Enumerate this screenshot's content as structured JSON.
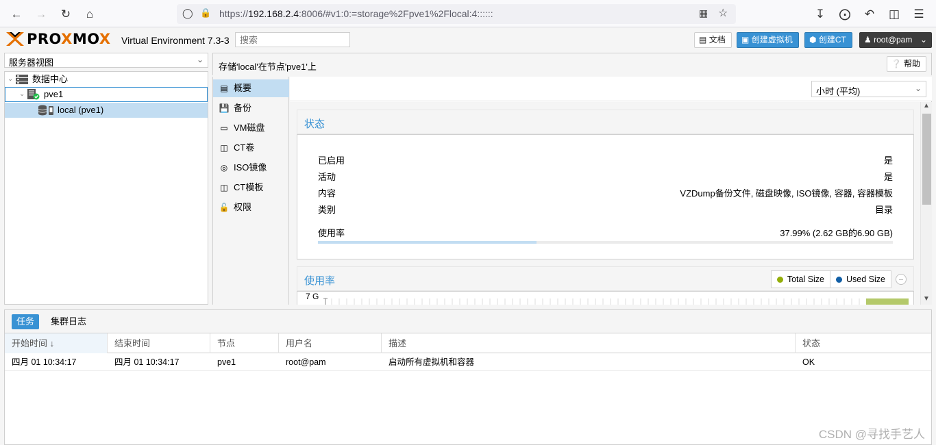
{
  "browser": {
    "url_prefix": "https://",
    "url_host": "192.168.2.4",
    "url_rest": ":8006/#v1:0:=storage%2Fpve1%2Flocal:4::::::"
  },
  "header": {
    "logo": "PROXMOX",
    "version": "Virtual Environment 7.3-3",
    "search_placeholder": "搜索",
    "docs": "文档",
    "create_vm": "创建虚拟机",
    "create_ct": "创建CT",
    "user": "root@pam"
  },
  "tree": {
    "view": "服务器视图",
    "datacenter": "数据中心",
    "node": "pve1",
    "storage": "local (pve1)"
  },
  "content": {
    "title": "存储'local'在节点'pve1'上",
    "help": "帮助",
    "timeframe": "小时 (平均)"
  },
  "submenu": {
    "items": [
      {
        "label": "概要",
        "icon": "book-icon"
      },
      {
        "label": "备份",
        "icon": "floppy-icon"
      },
      {
        "label": "VM磁盘",
        "icon": "hdd-icon"
      },
      {
        "label": "CT卷",
        "icon": "ct-volume-icon"
      },
      {
        "label": "ISO镜像",
        "icon": "disc-icon"
      },
      {
        "label": "CT模板",
        "icon": "template-icon"
      },
      {
        "label": "权限",
        "icon": "unlock-icon"
      }
    ]
  },
  "status": {
    "title": "状态",
    "rows": [
      {
        "key": "已启用",
        "value": "是"
      },
      {
        "key": "活动",
        "value": "是"
      },
      {
        "key": "内容",
        "value": "VZDump备份文件, 磁盘映像, ISO镜像, 容器, 容器模板"
      },
      {
        "key": "类别",
        "value": "目录"
      }
    ],
    "usage_label": "使用率",
    "usage_value": "37.99% (2.62 GB的6.90 GB)",
    "usage_fraction": 0.3799
  },
  "usage_chart": {
    "title": "使用率",
    "legend": [
      {
        "name": "Total Size",
        "color": "#94ae0a"
      },
      {
        "name": "Used Size",
        "color": "#115fa6"
      }
    ],
    "y_top_label": "7 G"
  },
  "bottom": {
    "tabs": [
      "任务",
      "集群日志"
    ],
    "columns": [
      "开始时间 ↓",
      "结束时间",
      "节点",
      "用户名",
      "描述",
      "状态"
    ],
    "rows": [
      {
        "start": "四月 01 10:34:17",
        "end": "四月 01 10:34:17",
        "node": "pve1",
        "user": "root@pam",
        "desc": "启动所有虚拟机和容器",
        "status": "OK"
      }
    ]
  },
  "watermark": "CSDN @寻找手艺人"
}
